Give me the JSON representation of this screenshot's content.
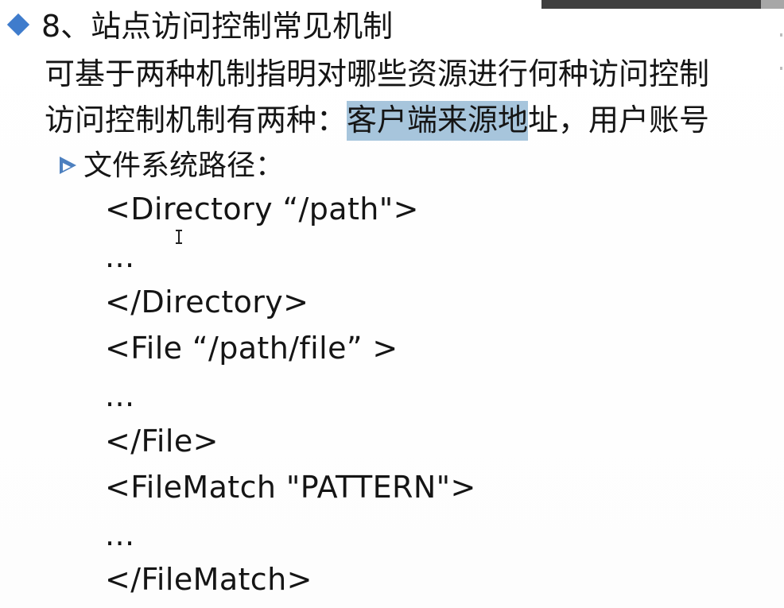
{
  "slide": {
    "title": "8、站点访问控制常见机制",
    "line1": "可基于两种机制指明对哪些资源进行何种访问控制",
    "line2_prefix": "访问控制机制有两种：",
    "line2_highlight": "客户端来源地",
    "line2_suffix": "址，用户账号",
    "subheading": "文件系统路径：",
    "code_lines": [
      "<Directory  “/path\">",
      "...",
      "</Directory>",
      "<File  “/path/file” >",
      "...",
      "</File>",
      "<FileMatch \"PATTERN\">",
      "...",
      "</FileMatch>"
    ]
  },
  "colors": {
    "bullet": "#3f7ccc",
    "highlight": "#a7c5dc"
  }
}
